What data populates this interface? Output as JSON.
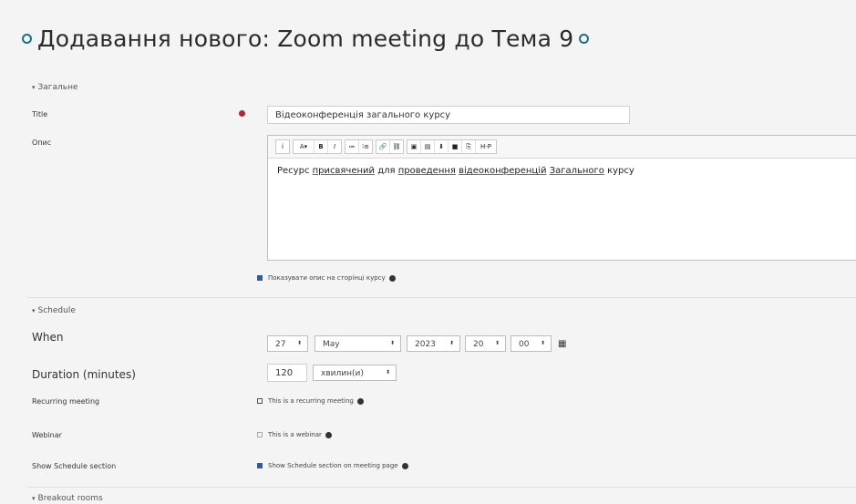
{
  "page": {
    "title": "Додавання нового: Zoom meeting до Тема 9"
  },
  "general": {
    "header": "Загальне",
    "title_label": "Title",
    "title_value": "Відеоконференція загального курсу",
    "desc_label": "Опис",
    "toolbar_buttons": [
      "i",
      "A▾",
      "B",
      "I",
      "≔",
      "⁝≡",
      "🔗",
      "⛓",
      "▣",
      "▤",
      "⬇",
      "■",
      "⎘",
      "H-P"
    ],
    "description_parts": [
      {
        "text": "Ресурс ",
        "u": false
      },
      {
        "text": "присвячений",
        "u": true
      },
      {
        "text": " для ",
        "u": false
      },
      {
        "text": "проведення",
        "u": true
      },
      {
        "text": " ",
        "u": false
      },
      {
        "text": "відеоконференцій",
        "u": true
      },
      {
        "text": " ",
        "u": false
      },
      {
        "text": "Загального",
        "u": true
      },
      {
        "text": " курсу",
        "u": false
      }
    ],
    "show_desc_label": "Показувати опис на сторінці курсу",
    "show_desc_checked": true
  },
  "schedule": {
    "header": "Schedule",
    "when_label": "When",
    "when_day": "27",
    "when_month": "May",
    "when_year": "2023",
    "when_hour": "20",
    "when_minute": "00",
    "duration_label": "Duration (minutes)",
    "duration_value": "120",
    "duration_unit": "хвилин(и)",
    "recurring_label": "Recurring meeting",
    "recurring_option": "This is a recurring meeting",
    "recurring_checked": false,
    "webinar_label": "Webinar",
    "webinar_option": "This is a webinar",
    "webinar_checked": false,
    "show_schedule_label": "Show Schedule section",
    "show_schedule_option": "Show Schedule section on meeting page",
    "show_schedule_checked": true
  },
  "breakout": {
    "header": "Breakout rooms"
  },
  "icons": {
    "caret": "▾",
    "select_caret": "⬍",
    "calendar": "▦"
  },
  "colors": {
    "accent": "#1c6e8a",
    "required": "#b02a2a",
    "checkbox_checked": "#2f5c9a"
  }
}
